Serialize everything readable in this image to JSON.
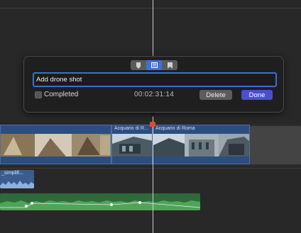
{
  "marker_popover": {
    "tabs": [
      {
        "icon": "marker-icon",
        "active": false
      },
      {
        "icon": "todo-icon",
        "active": true
      },
      {
        "icon": "chapter-icon",
        "active": false
      }
    ],
    "name_value": "Add drone shot",
    "completed_label": "Completed",
    "completed_checked": false,
    "timecode": "00:02:31:14",
    "delete_label": "Delete",
    "done_label": "Done"
  },
  "timeline": {
    "clips": [
      {
        "title": "Acquario di R..."
      },
      {
        "title": "Acquario di Roma"
      }
    ],
    "audio_clip_label": "_simplifi...",
    "colors": {
      "video_clip": "#2b4e7e",
      "music_clip": "#2e6a3a",
      "playhead_marker": "#e34a2f",
      "accent": "#4a4fd0"
    }
  }
}
